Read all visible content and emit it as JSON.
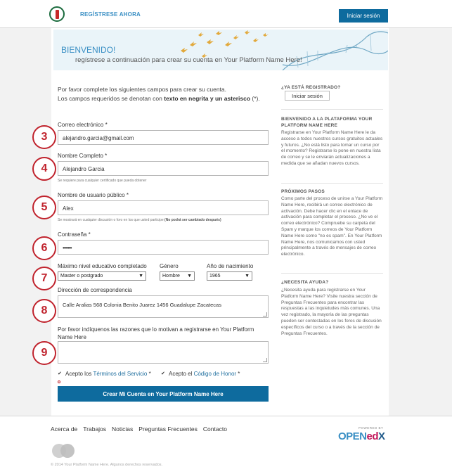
{
  "header": {
    "register_link": "REGÍSTRESE AHORA",
    "signin_button": "Iniciar sesión"
  },
  "banner": {
    "title": "BIENVENIDO!",
    "subtitle": "regístrese a continuación para crear su cuenta en Your Platform Name Here!"
  },
  "intro": {
    "line1": "Por favor complete los siguientes campos para crear su cuenta.",
    "line2_pre": "Los campos requeridos se denotan con ",
    "line2_bold": "texto en negrita y un asterisco",
    "line2_post": " (*)."
  },
  "form": {
    "email_label": "Correo electrónico *",
    "email_value": "alejandro.garcia@gmail.com",
    "fullname_label": "Nombre Completo *",
    "fullname_value": "Alejandro Garcia",
    "fullname_hint": "Se requiere para cualquier certificado que pueda obtener",
    "username_label": "Nombre de usuario público *",
    "username_value": "Alex",
    "username_hint": "Se mostrará en cualquier discusión o foro en los que usted participe ",
    "username_hint_bold": "(No podrá ser cambiado después)",
    "password_label": "Contraseña *",
    "password_value": "•••••••",
    "education_label": "Máximo nivel educativo completado",
    "education_value": "Master o postgrado",
    "gender_label": "Género",
    "gender_value": "Hombre",
    "birthyear_label": "Año de nacimiento",
    "birthyear_value": "1965",
    "address_label": "Dirección de correspondencia",
    "address_value": "Calle Aralias 568  Colonia Benito Juarez 1456  Guadalupe  Zacatecas",
    "reasons_label": "Por favor indíquenos las razones que lo motivan a registrarse en Your Platform Name Here",
    "terms_pre": "Acepto los ",
    "terms_link": "Términos del Servicio",
    "terms_post": " *",
    "honor_pre": "Acepto el ",
    "honor_link": "Código de Honor",
    "honor_post": " *",
    "submit_button": "Crear Mi Cuenta en Your Platform Name Here"
  },
  "badges": [
    "3",
    "4",
    "5",
    "6",
    "7",
    "8",
    "9"
  ],
  "sidebar": {
    "registered_heading": "¿YA ESTÁ REGISTRADO?",
    "registered_button": "Iniciar sesión",
    "welcome_heading": "BIENVENIDO A LA PLATAFORMA YOUR PLATFORM NAME HERE",
    "welcome_text": "Registrarse en Your Platform Name Here le da acceso a todos nuestros cursos gratuitos actuales y futuros. ¿No está listo para tomar un curso por el momento? Registrarse lo pone en nuestra lista de correo y se le enviarán actualizaciones a medida que se añadan nuevos cursos.",
    "steps_heading": "PRÓXIMOS PASOS",
    "steps_text": "Como parte del proceso de unirse a Your Platform Name Here, recibirá un correo electrónico de activación. Debe hacer clic en el enlace de activación para completar el proceso. ¿No ve el correo electrónico? Compruebe su carpeta del Spam y marque los correos de Your Platform Name Here como \"no es spam\". En Your Platform Name Here, nos comunicamos con usted principalmente a través de mensajes de correo electrónico.",
    "help_heading": "¿NECESITA AYUDA?",
    "help_text": "¿Necesita ayuda para registrarse en Your Platform Name Here? Visite nuestra sección de Preguntas Frecuentes para encontrar las respuestas a las inquietudes más comunes. Una vez registrado, la mayoría de las preguntas pueden ser contestadas en los foros de discusión específicos del curso o a través de la sección de Preguntas Frecuentes."
  },
  "footer": {
    "links": [
      "Acerca de",
      "Trabajos",
      "Noticias",
      "Preguntas Frecuentes",
      "Contacto"
    ],
    "powered_by": "POWERED BY",
    "brand_open": "OPEN",
    "brand_e": "ed",
    "brand_x": "X",
    "copyright": "© 2014 Your Platform Name Here. Algunos derechos reservados."
  },
  "colors": {
    "accent": "#0e6b9e",
    "link": "#3a8fc4",
    "annotation_red": "#c0232d"
  }
}
